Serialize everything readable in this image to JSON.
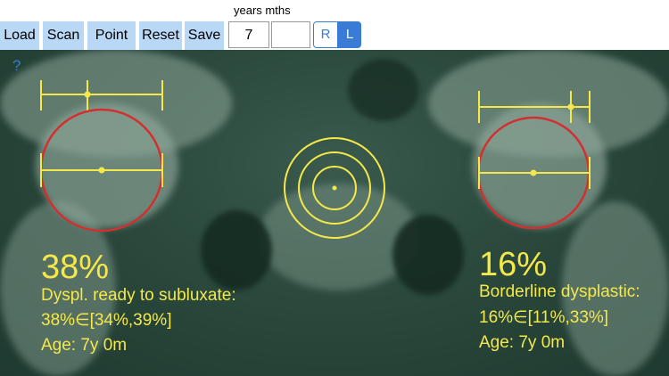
{
  "toolbar": {
    "load_label": "Load",
    "scan_label": "Scan",
    "point_label": "Point",
    "reset_label": "Reset",
    "save_label": "Save",
    "years_months_label": "years mths",
    "years_value": "7",
    "months_value": "",
    "side_r_label": "R",
    "side_l_label": "L",
    "selected_side": "L"
  },
  "help_label": "?",
  "left_hip": {
    "percent": "38%",
    "classification": "Dyspl. ready to subluxate:",
    "range": "38%∈[34%,39%]",
    "age": "Age: 7y 0m"
  },
  "right_hip": {
    "percent": "16%",
    "classification": "Borderline dysplastic:",
    "range": "16%∈[11%,33%]",
    "age": "Age: 7y 0m"
  },
  "colors": {
    "toolbar_button": "#b9d8f5",
    "accent_blue": "#3a7bd5",
    "overlay_yellow": "#f5e84a",
    "circle_red": "#d32f2f"
  },
  "icons": {
    "help": "question-mark-icon",
    "target": "concentric-target-icon"
  }
}
